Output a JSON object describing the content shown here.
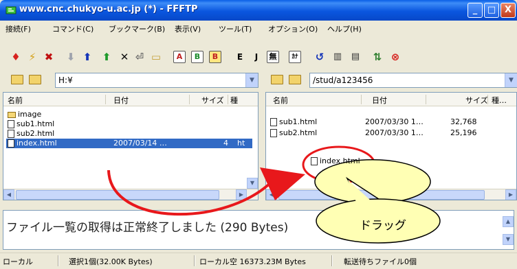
{
  "window": {
    "title": "www.cnc.chukyo-u.ac.jp (*) - FFFTP",
    "controls": [
      "_",
      "□",
      "X"
    ]
  },
  "menu": [
    "接続(F)",
    "コマンド(C)",
    "ブックマーク(B)",
    "表示(V)",
    "ツール(T)",
    "オプション(O)",
    "ヘルプ(H)"
  ],
  "toolbar": {
    "letters": {
      "a": "A",
      "b": "B",
      "e": "E",
      "j": "J",
      "none": "無",
      "kana": "ｶﾅ"
    }
  },
  "local": {
    "path": "H:¥",
    "columns": {
      "name": "名前",
      "date": "日付",
      "size": "サイズ",
      "type": "種"
    },
    "files": [
      {
        "name": "image",
        "date": "",
        "size": "",
        "type": ""
      },
      {
        "name": "sub1.html",
        "date": "",
        "size": "",
        "type": ""
      },
      {
        "name": "sub2.html",
        "date": "",
        "size": "",
        "type": ""
      },
      {
        "name": "index.html",
        "date": "2007/03/14 …",
        "size": "4",
        "type": "ht"
      }
    ]
  },
  "remote": {
    "path": "/stud/a123456",
    "columns": {
      "name": "名前",
      "date": "日付",
      "size": "サイズ",
      "type": "種…"
    },
    "files": [
      {
        "name": "sub1.html",
        "date": "2007/03/30 1…",
        "size": "32,768"
      },
      {
        "name": "sub2.html",
        "date": "2007/03/30 1…",
        "size": "25,196"
      }
    ]
  },
  "drag": {
    "file": "index.html",
    "label": "ドラッグ"
  },
  "log": {
    "text": "ファイル一覧の取得は正常終了しました (290 Bytes)"
  },
  "status": {
    "mode": "ローカル",
    "selection": "選択1個(32.00K Bytes)",
    "free": "ローカル空 16373.23M Bytes",
    "queue": "転送待ちファイル0個"
  },
  "colors": {
    "title_blue": "#0a56df",
    "selection": "#316ac5",
    "annotation_red": "#e8181b",
    "callout_yellow": "#ffffb4"
  }
}
